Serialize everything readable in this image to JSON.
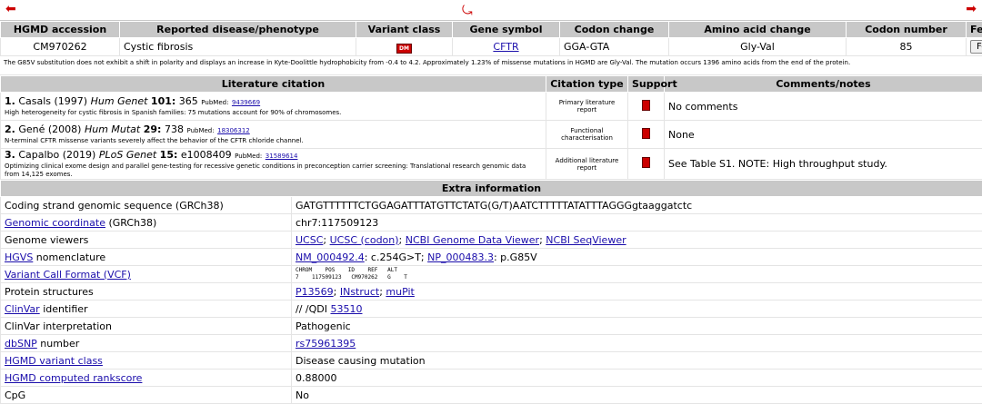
{
  "nav": {
    "prev_icon": "left-arrow-icon",
    "back_icon": "curved-arrow-icon",
    "next_icon": "right-arrow-icon"
  },
  "main_table": {
    "headers": [
      "HGMD accession",
      "Reported disease/phenotype",
      "Variant class",
      "Gene symbol",
      "Codon change",
      "Amino acid change",
      "Codon number",
      "Feedback"
    ],
    "accession": "CM970262",
    "disease": "Cystic fibrosis",
    "variant_badge": "DM",
    "gene": "CFTR",
    "codon_change": "GGA-GTA",
    "aa_change": "Gly-Val",
    "codon_number": "85",
    "feedback_button": "Feedback"
  },
  "description": "The G85V substitution does not exhibit a shift in polarity and displays an increase in Kyte-Doolittle hydrophobicity from -0.4 to 4.2. Approximately 1.23% of missense mutations in HGMD are Gly-Val. The mutation occurs 1396 amino acids from the end of the protein.",
  "literature": {
    "headers": [
      "Literature citation",
      "Citation type",
      "Support",
      "Comments/notes"
    ],
    "rows": [
      {
        "num": "1.",
        "author": "Casals (1997)",
        "journal": "Hum Genet",
        "vol": "101:",
        "pages": "365",
        "pubmed_label": "PubMed:",
        "pmid": "9439669",
        "title": "High heterogeneity for cystic fibrosis in Spanish families: 75 mutations account for 90% of chromosomes.",
        "type": "Primary literature report",
        "comment": "No comments"
      },
      {
        "num": "2.",
        "author": "Gené (2008)",
        "journal": "Hum Mutat",
        "vol": "29:",
        "pages": "738",
        "pubmed_label": "PubMed:",
        "pmid": "18306312",
        "title": "N-terminal CFTR missense variants severely affect the behavior of the CFTR chloride channel.",
        "type": "Functional characterisation",
        "comment": "None"
      },
      {
        "num": "3.",
        "author": "Capalbo (2019)",
        "journal": "PLoS Genet",
        "vol": "15:",
        "pages": "e1008409",
        "pubmed_label": "PubMed:",
        "pmid": "31589614",
        "title": "Optimizing clinical exome design and parallel gene-testing for recessive genetic conditions in preconception carrier screening: Translational research genomic data from 14,125 exomes.",
        "type": "Additional literature report",
        "comment": "See Table S1. NOTE: High throughput study."
      }
    ]
  },
  "extra": {
    "header": "Extra information",
    "coding_label": "Coding strand genomic sequence (GRCh38)",
    "coding_value": "GATGTTTTTTCTGGAGATTTATGTTCTATG(G/T)AATCTTTTTATATTTAGGGgtaaggatctc",
    "gc_link": "Genomic coordinate",
    "gc_suffix": " (GRCh38)",
    "gc_value": "chr7:117509123",
    "gv_label": "Genome viewers",
    "gv_ucsc": "UCSC",
    "gv_ucsc_codon": "UCSC (codon)",
    "gv_ncbi_gdv": "NCBI Genome Data Viewer",
    "gv_ncbi_seq": "NCBI SeqViewer",
    "hgvs_link": "HGVS",
    "hgvs_suffix": " nomenclature",
    "hgvs_nm": "NM_000492.4",
    "hgvs_c": ": c.254G>T; ",
    "hgvs_np": "NP_000483.3",
    "hgvs_p": ": p.G85V",
    "vcf_link": "Variant Call Format (VCF)",
    "vcf_header": "CHROM    POS    ID    REF   ALT",
    "vcf_row": "7    117509123   CM970262   G    T",
    "ps_label": "Protein structures",
    "ps_uniprot": "P13569",
    "ps_instruct": "INstruct",
    "ps_mupit": "muPit",
    "cv_link": "ClinVar",
    "cv_suffix": " identifier",
    "cv_prefix": "// /QDI ",
    "cv_id": "53510",
    "cvi_label": "ClinVar interpretation",
    "cvi_value": "Pathogenic",
    "dbsnp_link": "dbSNP",
    "dbsnp_suffix": " number",
    "dbsnp_value": "rs75961395",
    "hvc_link": "HGMD variant class",
    "hvc_value": "Disease causing mutation",
    "hrs_link": "HGMD computed rankscore",
    "hrs_value": "0.88000",
    "cpg_label": "CpG",
    "cpg_value": "No"
  }
}
